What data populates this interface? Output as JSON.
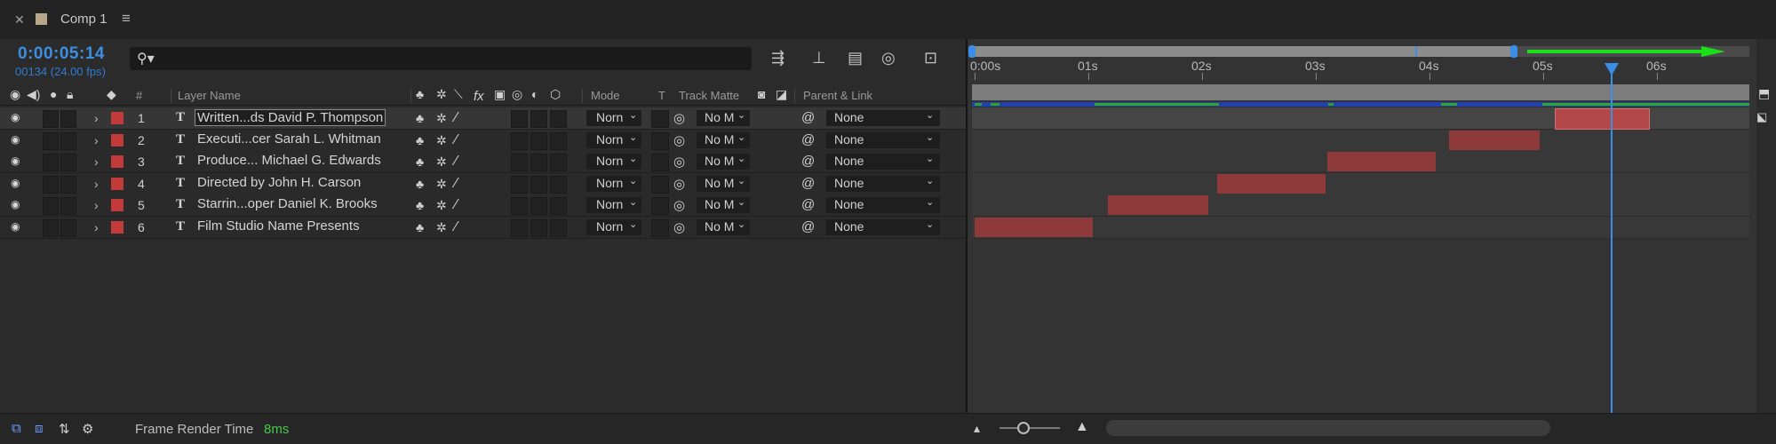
{
  "tab": {
    "close_icon": "close-icon",
    "title": "Comp 1",
    "menu_icon": "menu-icon"
  },
  "time": {
    "timecode": "0:00:05:14",
    "frame_info": "00134 (24.00 fps)"
  },
  "search": {
    "placeholder": ""
  },
  "headers": {
    "layer_number": "#",
    "layer_name": "Layer Name",
    "mode": "Mode",
    "t": "T",
    "track_matte": "Track Matte",
    "parent_link": "Parent & Link",
    "fx": "fx"
  },
  "layers": [
    {
      "num": "1",
      "name": "Written...ds David P. Thompson",
      "mode": "Norn",
      "matte": "No M",
      "parent": "None",
      "selected": true
    },
    {
      "num": "2",
      "name": "Executi...cer  Sarah L. Whitman",
      "mode": "Norn",
      "matte": "No M",
      "parent": "None",
      "selected": false
    },
    {
      "num": "3",
      "name": "Produce...  Michael G. Edwards",
      "mode": "Norn",
      "matte": "No M",
      "parent": "None",
      "selected": false
    },
    {
      "num": "4",
      "name": "Directed by  John H. Carson",
      "mode": "Norn",
      "matte": "No M",
      "parent": "None",
      "selected": false
    },
    {
      "num": "5",
      "name": "Starrin...oper Daniel K. Brooks",
      "mode": "Norn",
      "matte": "No M",
      "parent": "None",
      "selected": false
    },
    {
      "num": "6",
      "name": "Film Studio Name Presents",
      "mode": "Norn",
      "matte": "No M",
      "parent": "None",
      "selected": false
    }
  ],
  "ruler": [
    "0:00s",
    "01s",
    "02s",
    "03s",
    "04s",
    "05s",
    "06s"
  ],
  "status": {
    "frame_render_label": "Frame Render Time",
    "frame_render_value": "8ms"
  },
  "colors": {
    "accent": "#3a8ee6",
    "label_red": "#c23a3a",
    "bar": "#8e3a3a",
    "green": "#2ba62b"
  }
}
